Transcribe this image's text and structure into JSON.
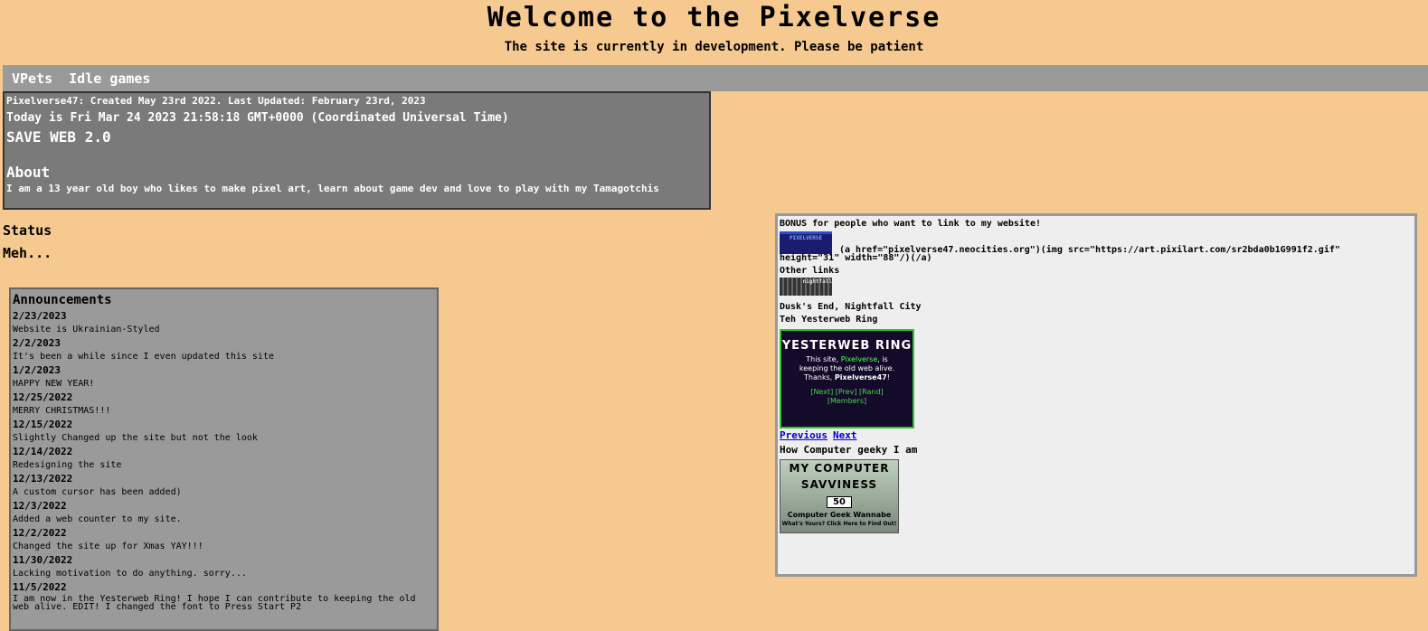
{
  "header": {
    "title": "Welcome to the Pixelverse",
    "subtitle": "The site is currently in development. Please be patient"
  },
  "nav": {
    "items": [
      "VPets",
      "Idle games"
    ]
  },
  "info": {
    "created": "Pixelverse47: Created May 23rd 2022. Last Updated: February 23rd, 2023",
    "today": "Today is Fri Mar 24 2023 21:58:18 GMT+0000 (Coordinated Universal Time)",
    "save": "SAVE WEB 2.0",
    "about_heading": "About",
    "about_text": "I am a 13 year old boy who likes to make pixel art, learn about game dev and love to play with my Tamagotchis"
  },
  "status": {
    "heading": "Status",
    "text": "Meh..."
  },
  "announcements": {
    "heading": "Announcements",
    "items": [
      {
        "date": "2/23/2023",
        "text": "Website is Ukrainian-Styled"
      },
      {
        "date": "2/2/2023",
        "text": "It's been a while since I even updated this site"
      },
      {
        "date": "1/2/2023",
        "text": "HAPPY NEW YEAR!"
      },
      {
        "date": "12/25/2022",
        "text": "MERRY CHRISTMAS!!!"
      },
      {
        "date": "12/15/2022",
        "text": "Slightly Changed up the site but not the look"
      },
      {
        "date": "12/14/2022",
        "text": "Redesigning the site"
      },
      {
        "date": "12/13/2022",
        "text": "A custom cursor has been added)"
      },
      {
        "date": "12/3/2022",
        "text": "Added a web counter to my site."
      },
      {
        "date": "12/2/2022",
        "text": "Changed the site up for Xmas YAY!!!"
      },
      {
        "date": "11/30/2022",
        "text": "Lacking motivation to do anything. sorry..."
      },
      {
        "date": "11/5/2022",
        "text": "I am now in the Yesterweb Ring! I hope I can contribute to keeping the old web alive. EDIT! I changed the font to Press Start P2"
      }
    ]
  },
  "sidebar": {
    "bonus": "BONUS for people who want to link to my website!",
    "badge_text": "PIXELVERSE",
    "code_line1": "(a href=\"pixelverse47.neocities.org\")(img src=\"https://art.pixilart.com/sr2bda0b1G991f2.gif\"",
    "code_line2": "height=\"31\" width=\"88\"/)(/a)",
    "other_links": "Other links",
    "other_badge_text": "nightfall",
    "dusk": "Dusk's End, Nightfall City",
    "ring_label": "Teh Yesterweb Ring",
    "ring": {
      "title": "YESTERWEB RING",
      "line1": "This site,",
      "site": "Pixelverse",
      "line1b": ", is",
      "line2": "keeping the old web alive.",
      "line3": "Thanks,",
      "owner": "Pixelverse47",
      "line3b": "!",
      "links": "[Next] [Prev] [Rand]",
      "members": "[Members]"
    },
    "previous": "Previous",
    "next": "Next",
    "geeky": "How Computer geeky I am",
    "savvy": {
      "title1": "MY COMPUTER",
      "title2": "SAVVINESS",
      "score": "50",
      "rank": "Computer Geek Wannabe",
      "link": "What's Yours? Click Here to Find Out!"
    }
  }
}
